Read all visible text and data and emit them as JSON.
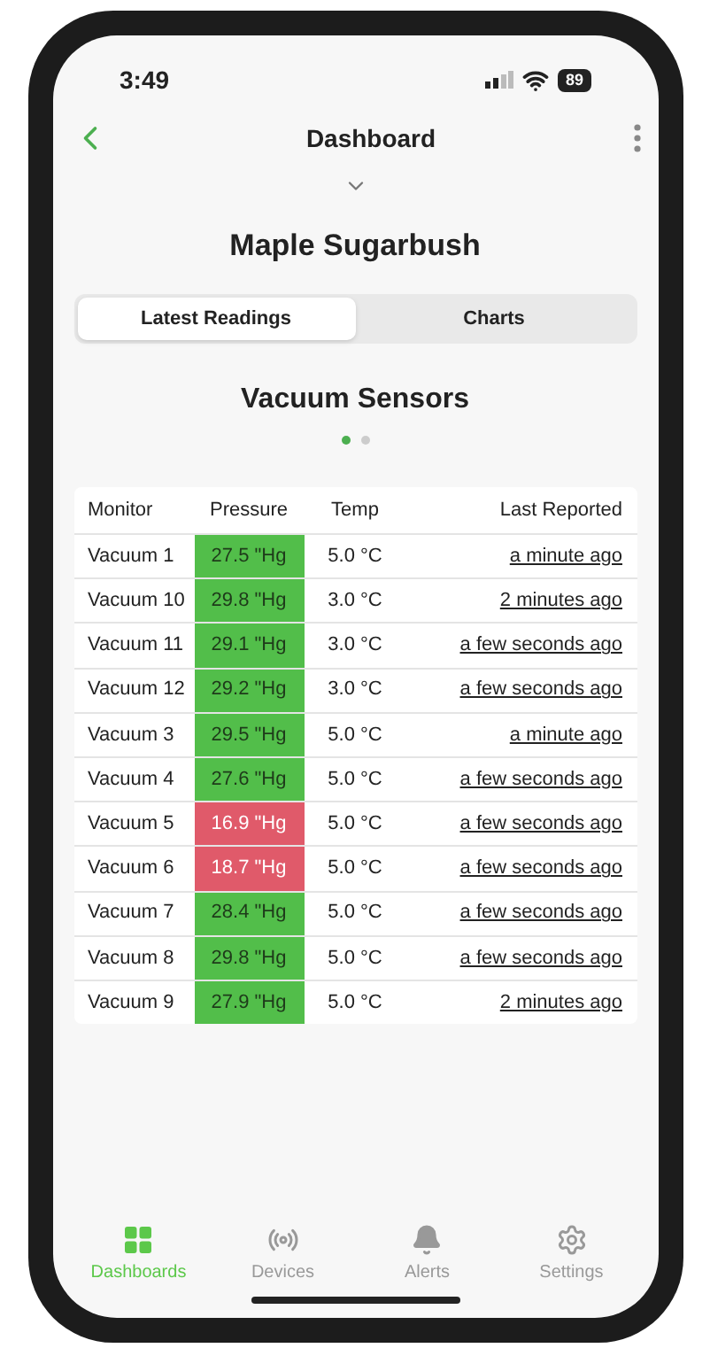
{
  "status_bar": {
    "time": "3:49",
    "battery": "89"
  },
  "header": {
    "title": "Dashboard"
  },
  "site": {
    "title": "Maple Sugarbush"
  },
  "tabs": [
    {
      "label": "Latest Readings",
      "selected": true
    },
    {
      "label": "Charts",
      "selected": false
    }
  ],
  "section": {
    "title": "Vacuum Sensors"
  },
  "pages": [
    {
      "selected": true
    },
    {
      "selected": false
    }
  ],
  "table": {
    "columns": [
      "Monitor",
      "Pressure",
      "Temp",
      "Last Reported"
    ],
    "rows": [
      {
        "monitor": "Vacuum 1",
        "pressure": "27.5 \"Hg",
        "alert": false,
        "temp": "5.0 °C",
        "reported": "a minute ago"
      },
      {
        "monitor": "Vacuum 10",
        "pressure": "29.8 \"Hg",
        "alert": false,
        "temp": "3.0 °C",
        "reported": "2 minutes ago"
      },
      {
        "monitor": "Vacuum 11",
        "pressure": "29.1 \"Hg",
        "alert": false,
        "temp": "3.0 °C",
        "reported": "a few seconds ago"
      },
      {
        "monitor": "Vacuum 12",
        "pressure": "29.2 \"Hg",
        "alert": false,
        "temp": "3.0 °C",
        "reported": "a few seconds ago"
      },
      {
        "monitor": "Vacuum 3",
        "pressure": "29.5 \"Hg",
        "alert": false,
        "temp": "5.0 °C",
        "reported": "a minute ago"
      },
      {
        "monitor": "Vacuum 4",
        "pressure": "27.6 \"Hg",
        "alert": false,
        "temp": "5.0 °C",
        "reported": "a few seconds ago"
      },
      {
        "monitor": "Vacuum 5",
        "pressure": "16.9 \"Hg",
        "alert": true,
        "temp": "5.0 °C",
        "reported": "a few seconds ago"
      },
      {
        "monitor": "Vacuum 6",
        "pressure": "18.7 \"Hg",
        "alert": true,
        "temp": "5.0 °C",
        "reported": "a few seconds ago"
      },
      {
        "monitor": "Vacuum 7",
        "pressure": "28.4 \"Hg",
        "alert": false,
        "temp": "5.0 °C",
        "reported": "a few seconds ago"
      },
      {
        "monitor": "Vacuum 8",
        "pressure": "29.8 \"Hg",
        "alert": false,
        "temp": "5.0 °C",
        "reported": "a few seconds ago"
      },
      {
        "monitor": "Vacuum 9",
        "pressure": "27.9 \"Hg",
        "alert": false,
        "temp": "5.0 °C",
        "reported": "2 minutes ago"
      }
    ]
  },
  "nav": [
    {
      "kind": "dashboards",
      "label": "Dashboards",
      "selected": true
    },
    {
      "kind": "devices",
      "label": "Devices",
      "selected": false
    },
    {
      "kind": "alerts",
      "label": "Alerts",
      "selected": false
    },
    {
      "kind": "settings",
      "label": "Settings",
      "selected": false
    }
  ]
}
